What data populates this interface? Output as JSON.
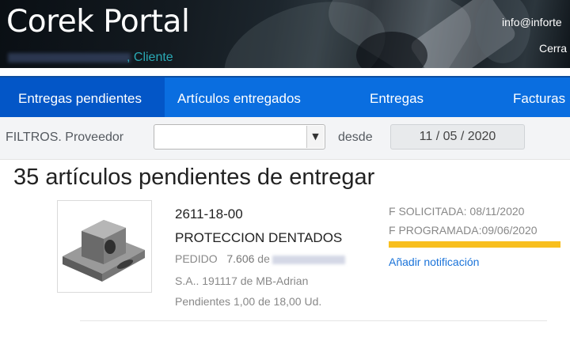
{
  "header": {
    "logo": "Corek Portal",
    "user_role": ", Cliente",
    "email": "info@inforte",
    "logout": "Cerra"
  },
  "nav": {
    "tabs": [
      {
        "label": "Entregas pendientes",
        "active": true
      },
      {
        "label": "Artículos entregados",
        "active": false
      },
      {
        "label": "Entregas",
        "active": false
      },
      {
        "label": "Facturas",
        "active": false
      }
    ]
  },
  "filters": {
    "label": "FILTROS. Proveedor",
    "provider_value": "",
    "desde_label": "desde",
    "date_value": "11 / 05 / 2020"
  },
  "main": {
    "title": "35 artículos pendientes de entregar",
    "items": [
      {
        "code": "2611-18-00",
        "name": "PROTECCION DENTADOS",
        "pedido_label": "PEDIDO",
        "pedido_num": "7.606",
        "pedido_de": "de",
        "provider": "S.A.. 191117 de MB-Adrian",
        "pendientes": "Pendientes 1,00 de 18,00 Ud.",
        "f_solicitada": "F SOLICITADA: 08/11/2020",
        "f_programada": "F PROGRAMADA:09/06/2020",
        "add_notification": "Añadir notificación",
        "status_color": "#f8bf1e"
      }
    ]
  },
  "colors": {
    "nav_bg": "#0a6ee0",
    "nav_active": "#0356c7",
    "link": "#1a73d9",
    "role_text": "#2aa9b5"
  }
}
